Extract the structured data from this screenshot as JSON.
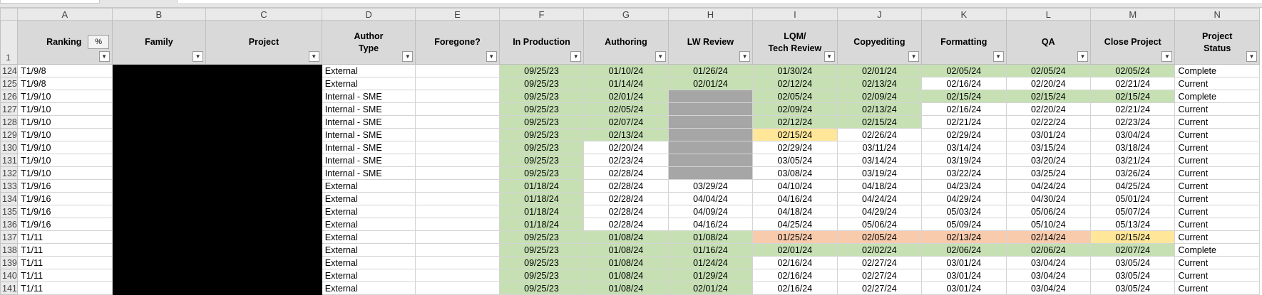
{
  "column_letters": [
    "A",
    "B",
    "C",
    "D",
    "E",
    "F",
    "G",
    "H",
    "I",
    "J",
    "K",
    "L",
    "M",
    "N"
  ],
  "header_row_number": "1",
  "headers": {
    "A": "Ranking",
    "percent_button": "%",
    "B": "Family",
    "C": "Project",
    "D1": "Author",
    "D2": "Type",
    "E": "Foregone?",
    "F": "In Production",
    "G": "Authoring",
    "H": "LW Review",
    "I1": "LQM/",
    "I2": "Tech Review",
    "J": "Copyediting",
    "K": "Formatting",
    "L": "QA",
    "M": "Close Project",
    "N1": "Project",
    "N2": "Status"
  },
  "filter_icon": "dropdown-arrow-icon",
  "colors": {
    "green": "#c6e0b4",
    "gray": "#a6a6a6",
    "yellow": "#ffe699",
    "orange": "#f8cbad",
    "redacted": "#000000"
  },
  "rows": [
    {
      "n": "124",
      "rank": "T1/9/8",
      "author": "External",
      "prod": "09/25/23",
      "auth": "01/10/24",
      "lw": "01/26/24",
      "lqm": "01/30/24",
      "copy": "02/01/24",
      "fmt": "02/05/24",
      "qa": "02/05/24",
      "close": "02/05/24",
      "status": "Complete"
    },
    {
      "n": "125",
      "rank": "T1/9/8",
      "author": "External",
      "prod": "09/25/23",
      "auth": "01/14/24",
      "lw": "02/01/24",
      "lqm": "02/12/24",
      "copy": "02/13/24",
      "fmt": "02/16/24",
      "qa": "02/20/24",
      "close": "02/21/24",
      "status": "Current"
    },
    {
      "n": "126",
      "rank": "T1/9/10",
      "author": "Internal - SME",
      "prod": "09/25/23",
      "auth": "02/01/24",
      "lw": "",
      "lqm": "02/05/24",
      "copy": "02/09/24",
      "fmt": "02/15/24",
      "qa": "02/15/24",
      "close": "02/15/24",
      "status": "Complete"
    },
    {
      "n": "127",
      "rank": "T1/9/10",
      "author": "Internal - SME",
      "prod": "09/25/23",
      "auth": "02/05/24",
      "lw": "",
      "lqm": "02/09/24",
      "copy": "02/13/24",
      "fmt": "02/16/24",
      "qa": "02/20/24",
      "close": "02/21/24",
      "status": "Current"
    },
    {
      "n": "128",
      "rank": "T1/9/10",
      "author": "Internal - SME",
      "prod": "09/25/23",
      "auth": "02/07/24",
      "lw": "",
      "lqm": "02/12/24",
      "copy": "02/15/24",
      "fmt": "02/21/24",
      "qa": "02/22/24",
      "close": "02/23/24",
      "status": "Current"
    },
    {
      "n": "129",
      "rank": "T1/9/10",
      "author": "Internal - SME",
      "prod": "09/25/23",
      "auth": "02/13/24",
      "lw": "",
      "lqm": "02/15/24",
      "copy": "02/26/24",
      "fmt": "02/29/24",
      "qa": "03/01/24",
      "close": "03/04/24",
      "status": "Current"
    },
    {
      "n": "130",
      "rank": "T1/9/10",
      "author": "Internal - SME",
      "prod": "09/25/23",
      "auth": "02/20/24",
      "lw": "",
      "lqm": "02/29/24",
      "copy": "03/11/24",
      "fmt": "03/14/24",
      "qa": "03/15/24",
      "close": "03/18/24",
      "status": "Current"
    },
    {
      "n": "131",
      "rank": "T1/9/10",
      "author": "Internal - SME",
      "prod": "09/25/23",
      "auth": "02/23/24",
      "lw": "",
      "lqm": "03/05/24",
      "copy": "03/14/24",
      "fmt": "03/19/24",
      "qa": "03/20/24",
      "close": "03/21/24",
      "status": "Current"
    },
    {
      "n": "132",
      "rank": "T1/9/10",
      "author": "Internal - SME",
      "prod": "09/25/23",
      "auth": "02/28/24",
      "lw": "",
      "lqm": "03/08/24",
      "copy": "03/19/24",
      "fmt": "03/22/24",
      "qa": "03/25/24",
      "close": "03/26/24",
      "status": "Current"
    },
    {
      "n": "133",
      "rank": "T1/9/16",
      "author": "External",
      "prod": "01/18/24",
      "auth": "02/28/24",
      "lw": "03/29/24",
      "lqm": "04/10/24",
      "copy": "04/18/24",
      "fmt": "04/23/24",
      "qa": "04/24/24",
      "close": "04/25/24",
      "status": "Current"
    },
    {
      "n": "134",
      "rank": "T1/9/16",
      "author": "External",
      "prod": "01/18/24",
      "auth": "02/28/24",
      "lw": "04/04/24",
      "lqm": "04/16/24",
      "copy": "04/24/24",
      "fmt": "04/29/24",
      "qa": "04/30/24",
      "close": "05/01/24",
      "status": "Current"
    },
    {
      "n": "135",
      "rank": "T1/9/16",
      "author": "External",
      "prod": "01/18/24",
      "auth": "02/28/24",
      "lw": "04/09/24",
      "lqm": "04/18/24",
      "copy": "04/29/24",
      "fmt": "05/03/24",
      "qa": "05/06/24",
      "close": "05/07/24",
      "status": "Current"
    },
    {
      "n": "136",
      "rank": "T1/9/16",
      "author": "External",
      "prod": "01/18/24",
      "auth": "02/28/24",
      "lw": "04/16/24",
      "lqm": "04/25/24",
      "copy": "05/06/24",
      "fmt": "05/09/24",
      "qa": "05/10/24",
      "close": "05/13/24",
      "status": "Current"
    },
    {
      "n": "137",
      "rank": "T1/11",
      "author": "External",
      "prod": "09/25/23",
      "auth": "01/08/24",
      "lw": "01/08/24",
      "lqm": "01/25/24",
      "copy": "02/05/24",
      "fmt": "02/13/24",
      "qa": "02/14/24",
      "close": "02/15/24",
      "status": "Current"
    },
    {
      "n": "138",
      "rank": "T1/11",
      "author": "External",
      "prod": "09/25/23",
      "auth": "01/08/24",
      "lw": "01/16/24",
      "lqm": "02/01/24",
      "copy": "02/02/24",
      "fmt": "02/06/24",
      "qa": "02/06/24",
      "close": "02/07/24",
      "status": "Complete"
    },
    {
      "n": "139",
      "rank": "T1/11",
      "author": "External",
      "prod": "09/25/23",
      "auth": "01/08/24",
      "lw": "01/24/24",
      "lqm": "02/16/24",
      "copy": "02/27/24",
      "fmt": "03/01/24",
      "qa": "03/04/24",
      "close": "03/05/24",
      "status": "Current"
    },
    {
      "n": "140",
      "rank": "T1/11",
      "author": "External",
      "prod": "09/25/23",
      "auth": "01/08/24",
      "lw": "01/29/24",
      "lqm": "02/16/24",
      "copy": "02/27/24",
      "fmt": "03/01/24",
      "qa": "03/04/24",
      "close": "03/05/24",
      "status": "Current"
    },
    {
      "n": "141",
      "rank": "T1/11",
      "author": "External",
      "prod": "09/25/23",
      "auth": "01/08/24",
      "lw": "02/01/24",
      "lqm": "02/16/24",
      "copy": "02/27/24",
      "fmt": "03/01/24",
      "qa": "03/04/24",
      "close": "03/05/24",
      "status": "Current"
    }
  ]
}
